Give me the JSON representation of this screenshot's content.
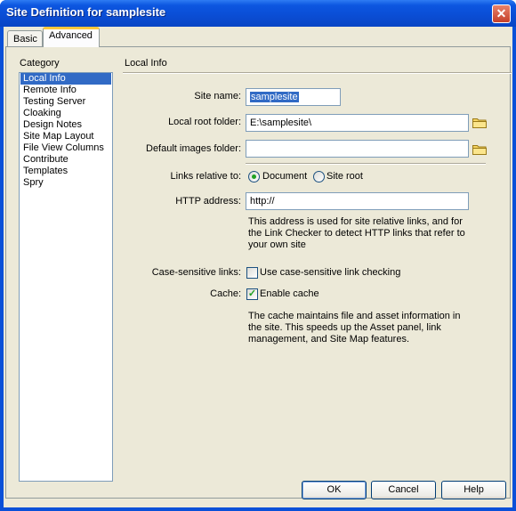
{
  "window": {
    "title": "Site Definition for samplesite"
  },
  "tabs": [
    {
      "label": "Basic",
      "active": false
    },
    {
      "label": "Advanced",
      "active": true
    }
  ],
  "category": {
    "label": "Category",
    "items": [
      "Local Info",
      "Remote Info",
      "Testing Server",
      "Cloaking",
      "Design Notes",
      "Site Map Layout",
      "File View Columns",
      "Contribute",
      "Templates",
      "Spry"
    ],
    "selected": "Local Info"
  },
  "section": {
    "title": "Local Info"
  },
  "form": {
    "site_name": {
      "label": "Site name:",
      "value": "samplesite"
    },
    "local_root": {
      "label": "Local root folder:",
      "value": "E:\\samplesite\\"
    },
    "default_images": {
      "label": "Default images folder:",
      "value": ""
    },
    "links_relative": {
      "label": "Links relative to:",
      "option_document": "Document",
      "option_site_root": "Site root",
      "selected": "Document"
    },
    "http_address": {
      "label": "HTTP address:",
      "value": "http://",
      "help": "This address is used for site relative links, and for the Link Checker to detect HTTP links that refer to your own site"
    },
    "case_sensitive": {
      "label": "Case-sensitive links:",
      "option": "Use case-sensitive link checking",
      "checked": false
    },
    "cache": {
      "label": "Cache:",
      "option": "Enable cache",
      "checked": true,
      "help": "The cache maintains file and asset information in the site.  This speeds up the Asset panel, link management, and Site Map features."
    }
  },
  "buttons": {
    "ok": "OK",
    "cancel": "Cancel",
    "help": "Help"
  },
  "icons": {
    "close": "close-icon",
    "folder": "folder-icon"
  }
}
